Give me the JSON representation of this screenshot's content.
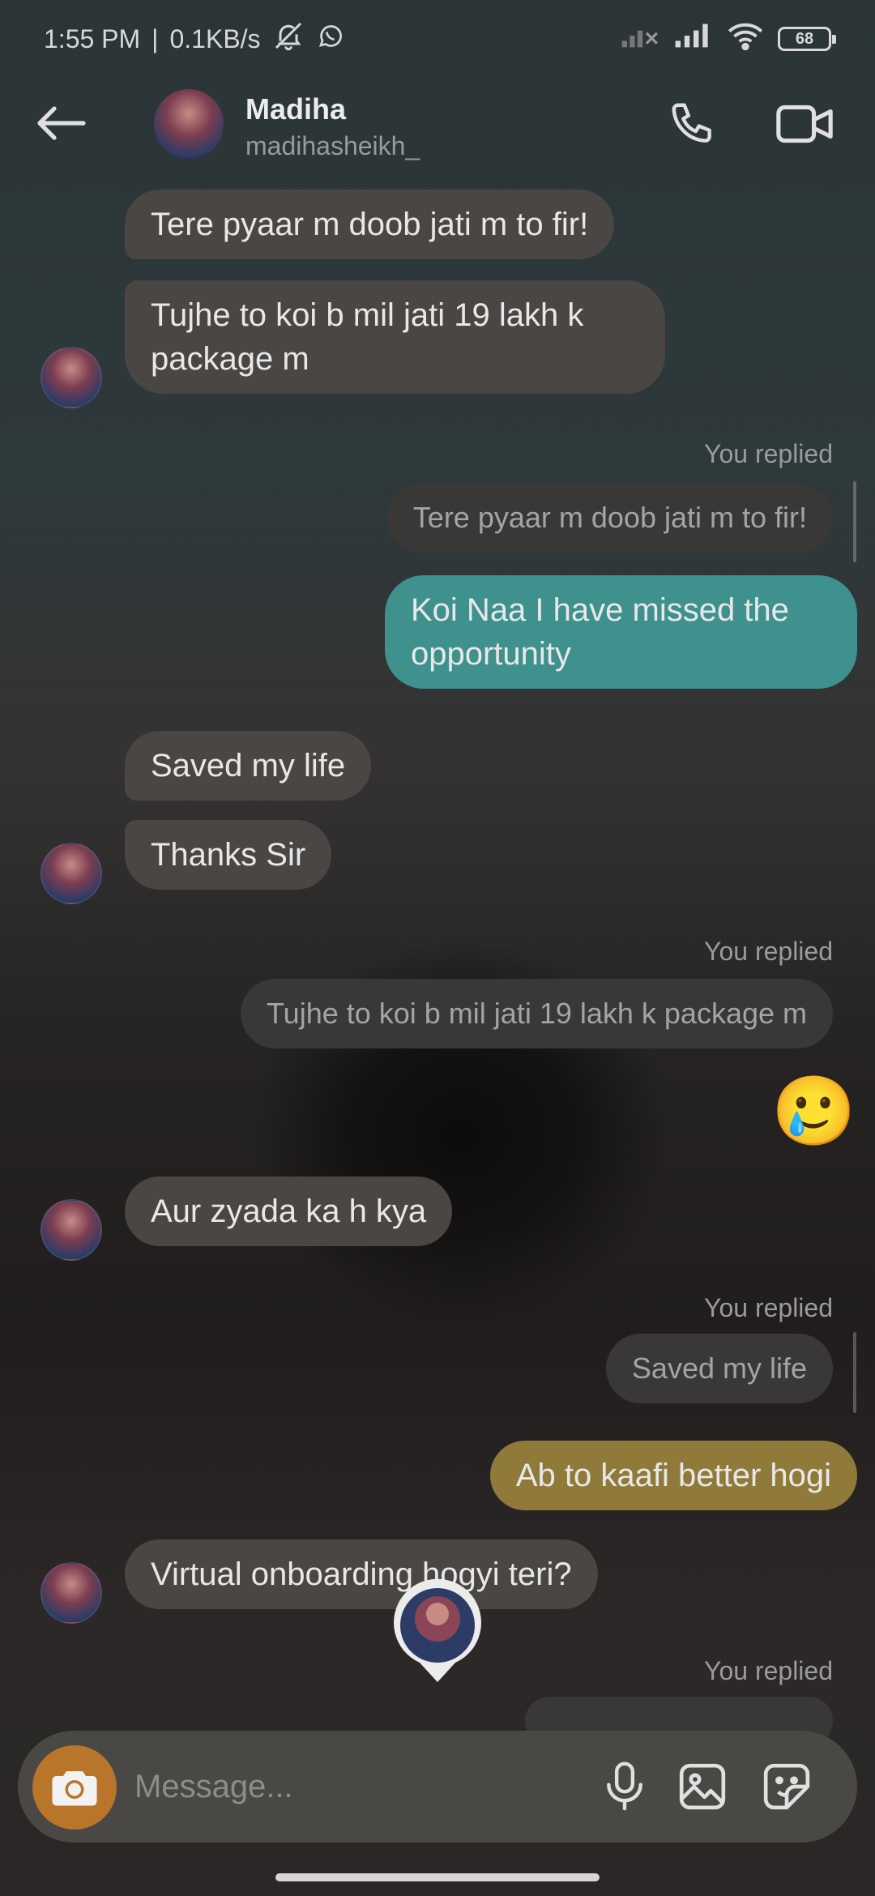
{
  "status_bar": {
    "time": "1:55 PM",
    "network_speed": "0.1KB/s",
    "separator": "|",
    "battery": "68",
    "icons": [
      "mute-icon",
      "whatsapp-icon",
      "signal-off-icon",
      "signal-icon",
      "wifi-icon",
      "battery-icon"
    ]
  },
  "header": {
    "name": "Madiha",
    "handle": "madihasheikh_",
    "icons": [
      "back-arrow-icon",
      "phone-icon",
      "video-camera-icon"
    ]
  },
  "messages": [
    {
      "text": "Tere pyaar m doob jati m to fir!"
    },
    {
      "text": "Tujhe to koi b mil jati 19 lakh k package m"
    },
    {
      "reply_label": "You replied",
      "quote": "Tere pyaar m doob jati m to fir!",
      "text": "Koi Naa I have missed the opportunity"
    },
    {
      "text": "Saved my life"
    },
    {
      "text": "Thanks Sir"
    },
    {
      "reply_label": "You replied",
      "quote": "Tujhe to koi b mil jati 19 lakh k package m",
      "emoji": "🥲"
    },
    {
      "text": "Aur zyada ka h kya"
    },
    {
      "reply_label": "You replied",
      "quote": "Saved my life",
      "text": "Ab to kaafi better hogi"
    },
    {
      "text": "Virtual onboarding hogyi teri?"
    },
    {
      "reply_label": "You replied"
    }
  ],
  "composer": {
    "placeholder": "Message...",
    "icons": [
      "camera-icon",
      "microphone-icon",
      "gallery-icon",
      "sticker-icon"
    ]
  },
  "colors": {
    "incoming_bubble": "#4a4643",
    "outgoing_teal": "#3f918d",
    "outgoing_gold": "#8f7a3a",
    "camera_button": "#b9752a"
  }
}
